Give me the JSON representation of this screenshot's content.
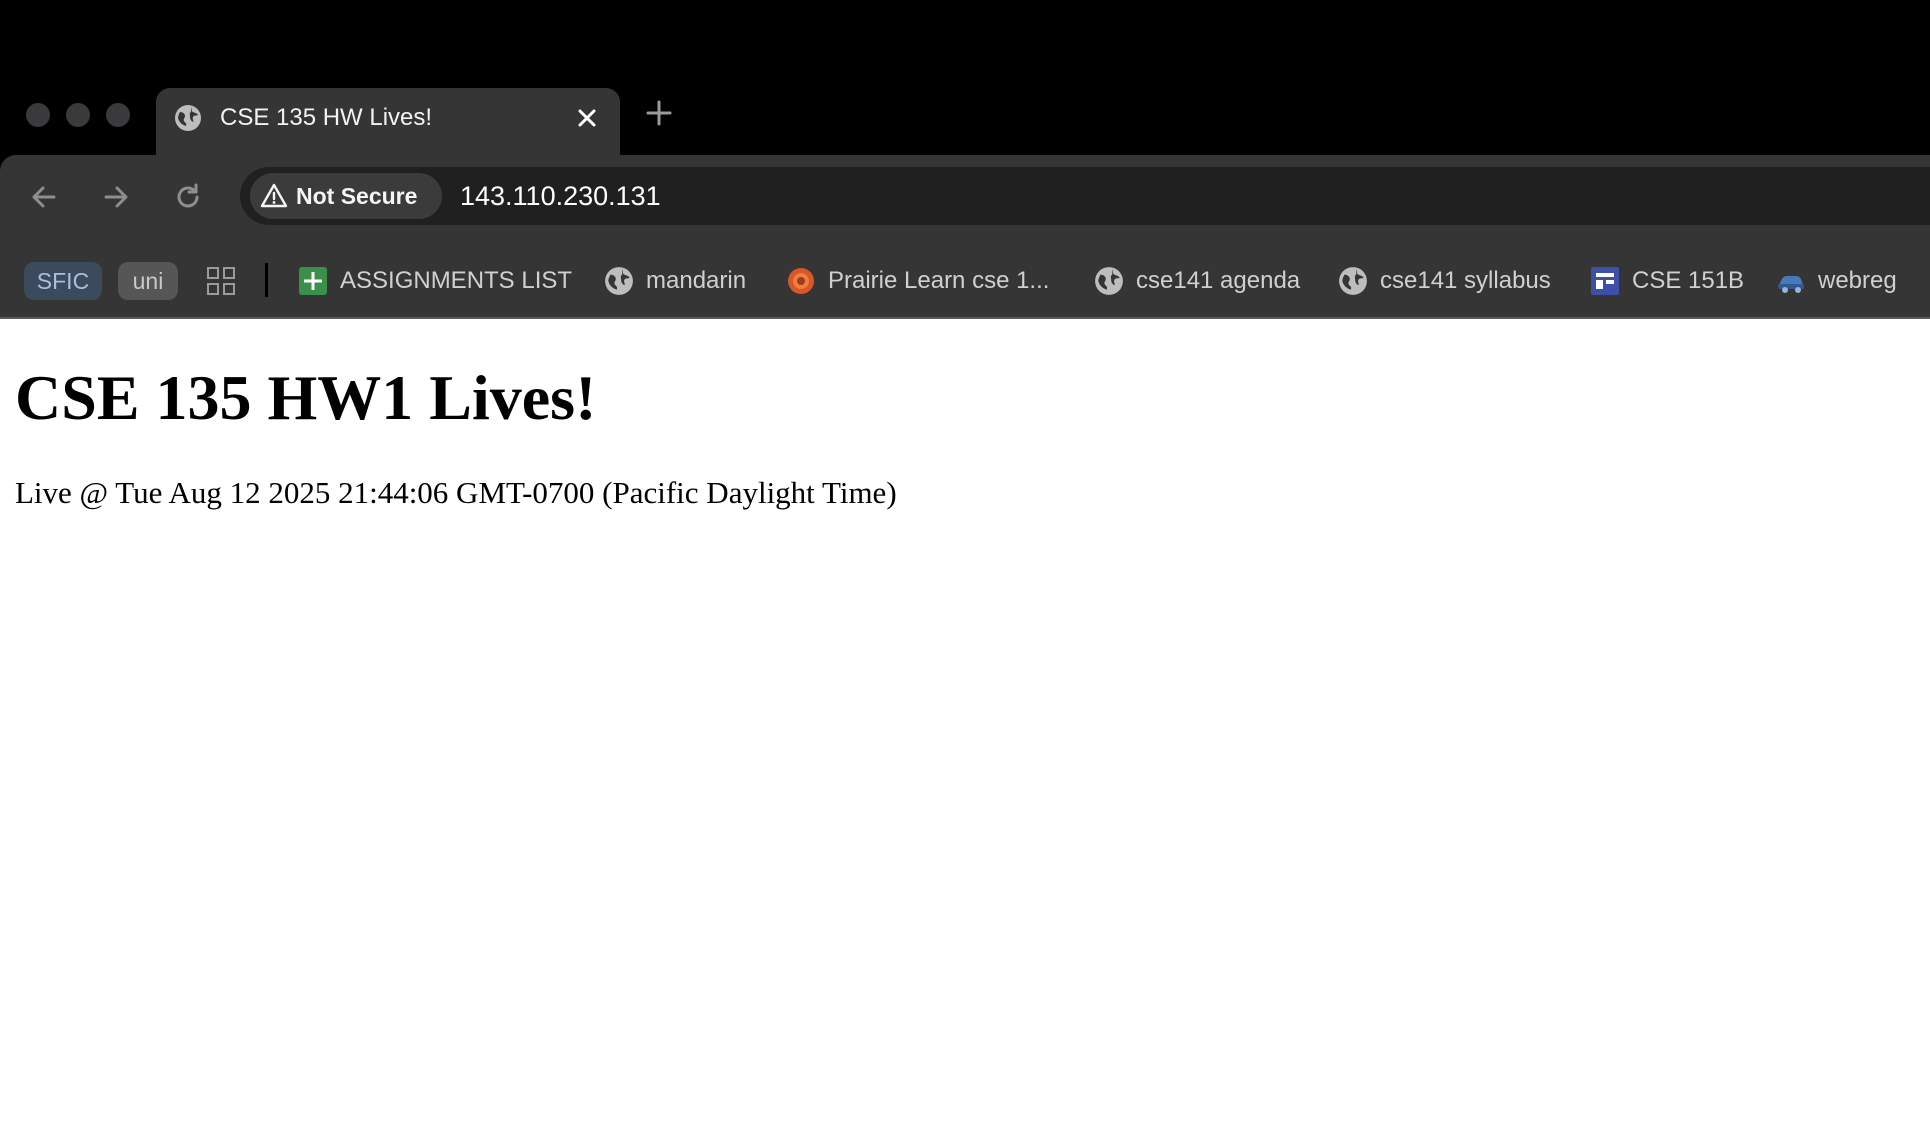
{
  "browser": {
    "tab": {
      "title": "CSE 135 HW Lives!",
      "icon": "globe-icon"
    },
    "address_bar": {
      "security_label": "Not Secure",
      "url": "143.110.230.131"
    },
    "bookmarks": {
      "chips": [
        {
          "label": "SFIC",
          "color": "#3c4a5e"
        },
        {
          "label": "uni",
          "color": "#565656"
        }
      ],
      "items": [
        {
          "label": "ASSIGNMENTS LIST",
          "icon": "sheets-plus-icon"
        },
        {
          "label": "mandarin",
          "icon": "globe-icon"
        },
        {
          "label": "Prairie Learn cse 1...",
          "icon": "flower-icon"
        },
        {
          "label": "cse141 agenda",
          "icon": "globe-icon"
        },
        {
          "label": "cse141 syllabus",
          "icon": "globe-icon"
        },
        {
          "label": "CSE 151B",
          "icon": "site-layout-icon"
        },
        {
          "label": "webreg",
          "icon": "car-icon"
        }
      ]
    }
  },
  "page": {
    "heading": "CSE 135 HW1 Lives!",
    "live_text": "Live @ Tue Aug 12 2025 21:44:06 GMT-0700 (Pacific Daylight Time)"
  }
}
